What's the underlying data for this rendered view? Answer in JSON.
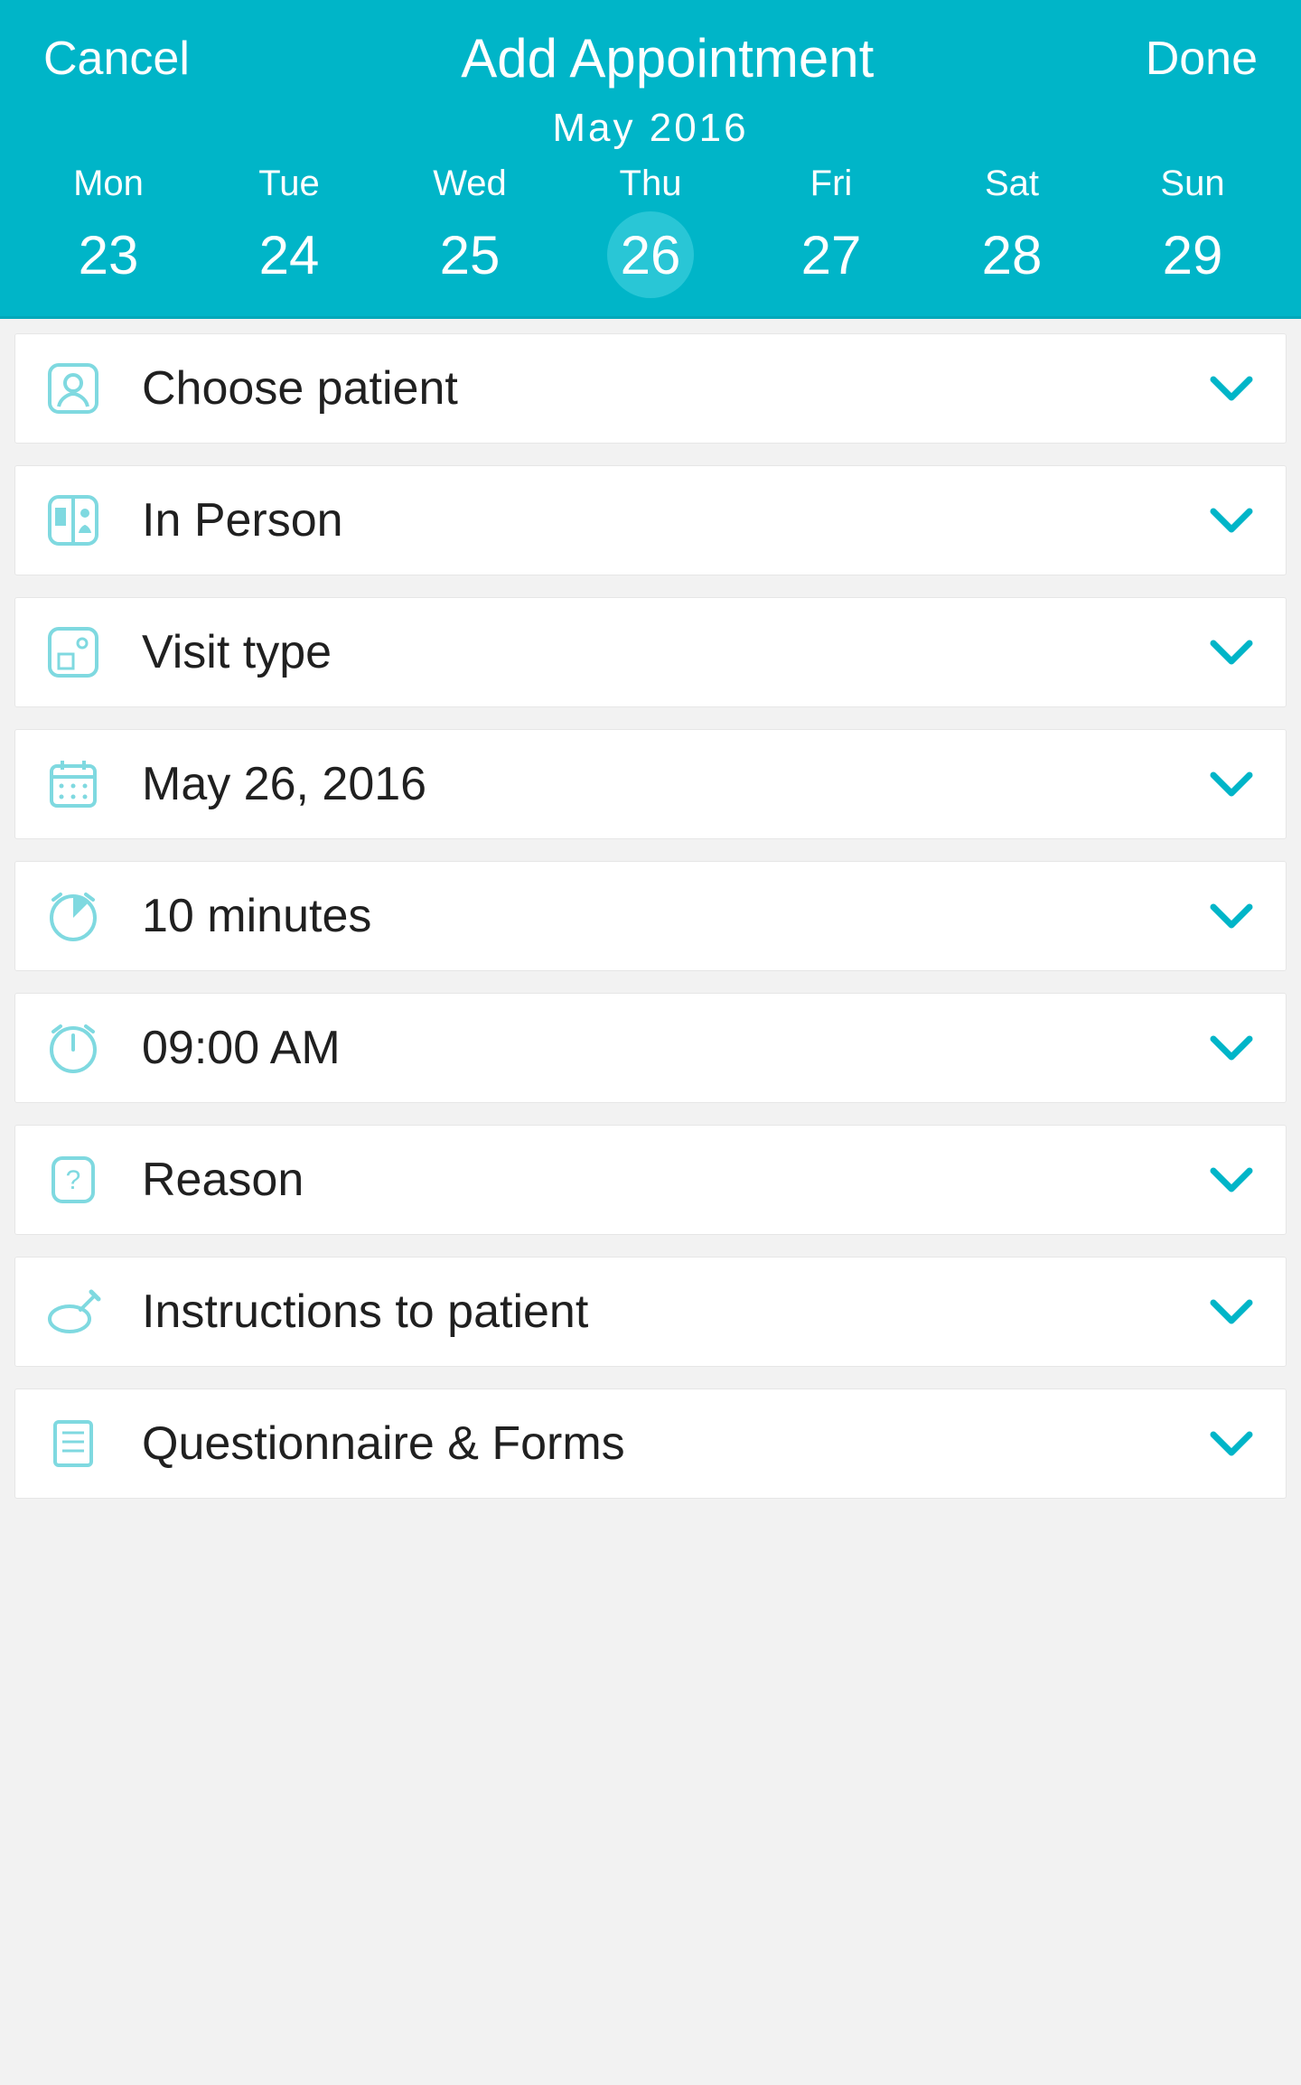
{
  "header": {
    "cancel": "Cancel",
    "title": "Add Appointment",
    "done": "Done",
    "month": "May 2016"
  },
  "week": [
    {
      "name": "Mon",
      "num": "23",
      "selected": false
    },
    {
      "name": "Tue",
      "num": "24",
      "selected": false
    },
    {
      "name": "Wed",
      "num": "25",
      "selected": false
    },
    {
      "name": "Thu",
      "num": "26",
      "selected": true
    },
    {
      "name": "Fri",
      "num": "27",
      "selected": false
    },
    {
      "name": "Sat",
      "num": "28",
      "selected": false
    },
    {
      "name": "Sun",
      "num": "29",
      "selected": false
    }
  ],
  "rows": [
    {
      "icon": "patient",
      "label": "Choose patient"
    },
    {
      "icon": "inperson",
      "label": "In Person"
    },
    {
      "icon": "visittype",
      "label": "Visit type"
    },
    {
      "icon": "calendar",
      "label": "May 26, 2016"
    },
    {
      "icon": "duration",
      "label": "10 minutes"
    },
    {
      "icon": "time",
      "label": "09:00 AM"
    },
    {
      "icon": "reason",
      "label": "Reason"
    },
    {
      "icon": "instructions",
      "label": "Instructions to patient"
    },
    {
      "icon": "forms",
      "label": "Questionnaire & Forms"
    }
  ],
  "colors": {
    "accent": "#00b5c8",
    "iconTint": "#7fd9e0"
  }
}
